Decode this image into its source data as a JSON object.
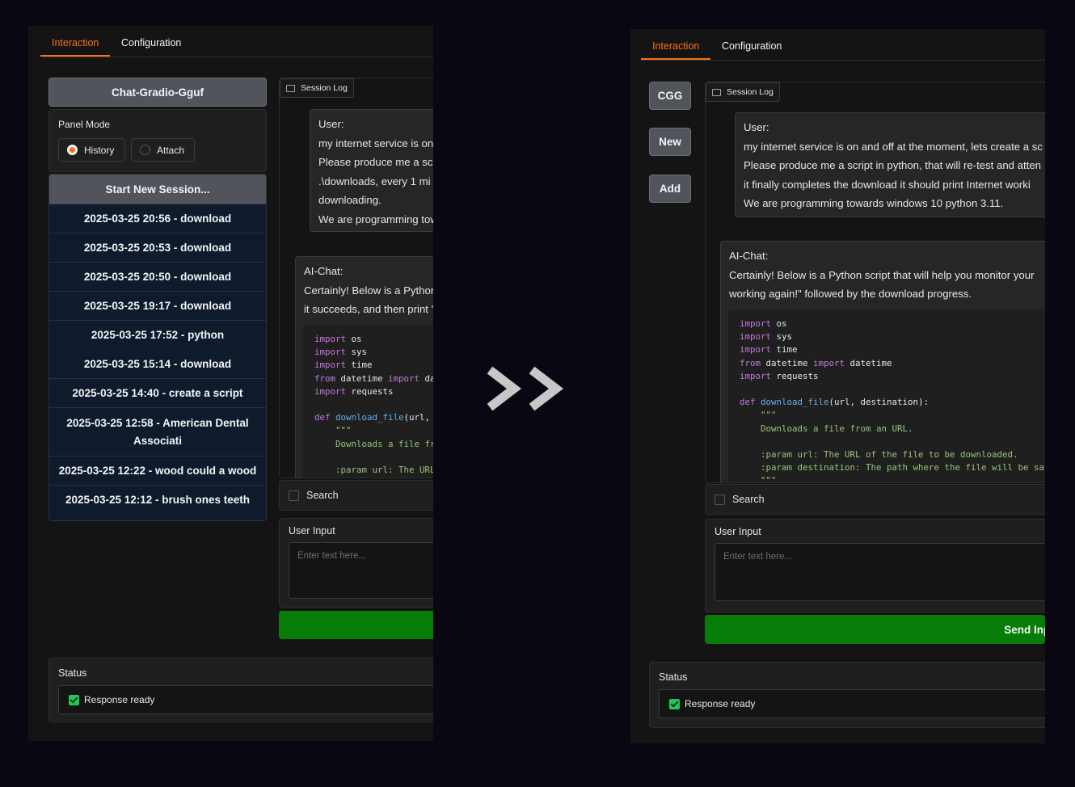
{
  "colors": {
    "accent": "#f97316",
    "send": "#087c08",
    "background": "#0b0712"
  },
  "tabs": {
    "interaction": "Interaction",
    "configuration": "Configuration"
  },
  "left": {
    "app_title": "Chat-Gradio-Gguf",
    "panel_mode": {
      "label": "Panel Mode",
      "options": [
        "History",
        "Attach"
      ],
      "selected": "History"
    },
    "start_new_session": "Start New Session...",
    "sessions": [
      "2025-03-25 20:56 - download",
      "2025-03-25 20:53 - download",
      "2025-03-25 20:50 - download",
      "2025-03-25 19:17 - download",
      "2025-03-25 17:52 - python",
      "2025-03-25 15:14 - download",
      "2025-03-25 14:40 - create a script",
      "2025-03-25 12:58 - American Dental Associati",
      "2025-03-25 12:22 - wood could a wood",
      "2025-03-25 12:12 - brush ones teeth"
    ]
  },
  "right": {
    "side_buttons": [
      "CGG",
      "New",
      "Add"
    ]
  },
  "chat": {
    "log_label": "Session Log",
    "user_label": "User:",
    "user_lines_left": [
      "my internet service is on",
      "Please produce me a scr",
      ".\\downloads, every 1 mi",
      "downloading.",
      "We are programming tow"
    ],
    "user_lines_right": [
      "my internet service is on and off at the moment, lets create a sc",
      "Please produce me a script in python, that will re-test and atten",
      "it finally completes the download it should print Internet worki",
      "We are programming towards windows 10 python 3.11."
    ],
    "ai_label": "AI-Chat:",
    "ai_lines_left": [
      "Certainly! Below is a Python",
      "it succeeds, and then print '"
    ],
    "ai_lines_right": [
      "Certainly! Below is a Python script that will help you monitor your",
      "working again!\" followed by the download progress."
    ],
    "code": {
      "kw_import": "import",
      "kw_from": "from",
      "kw_def": "def",
      "mod_os": " os",
      "mod_sys": " sys",
      "mod_time": " time",
      "mod_datetime": " datetime ",
      "datetime_trunc_left": " da",
      "datetime_right": " datetime",
      "mod_requests": " requests",
      "fn_name": "download_file",
      "args_left": "(url,",
      "args_right": "(url, destination):",
      "docq": "\"\"\"",
      "doc_left": "Downloads a file fr",
      "doc_right": "Downloads a file from an URL.",
      "param1_left": ":param url: The URL",
      "param1_right": ":param url: The URL of the file to be downloaded.",
      "param2_right": ":param destination: The path where the file will be sav"
    },
    "search_label": "Search",
    "user_input_label": "User Input",
    "input_placeholder": "Enter text here...",
    "send_label": "Send Input"
  },
  "status": {
    "label": "Status",
    "value": "Response ready"
  }
}
